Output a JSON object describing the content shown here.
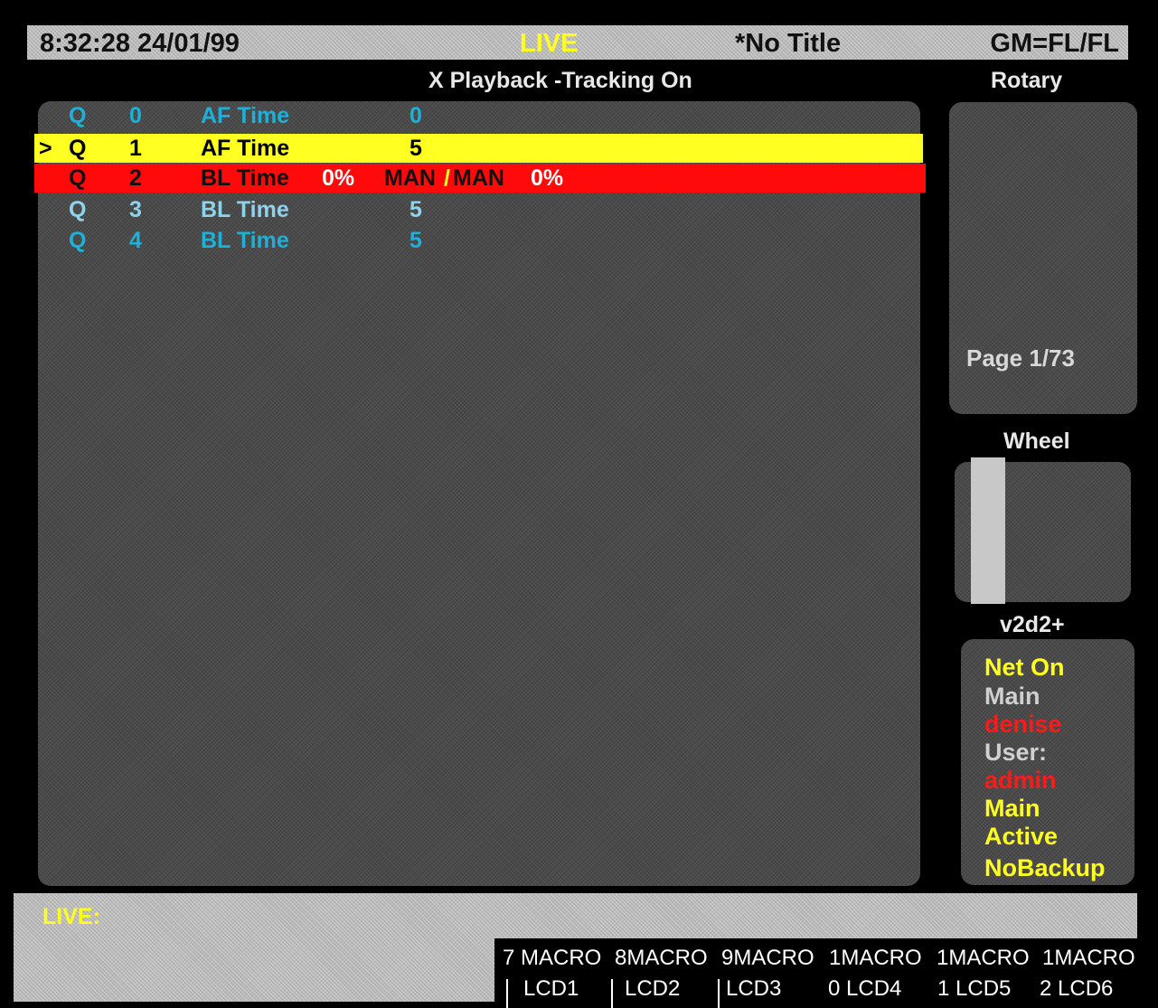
{
  "status_bar": {
    "clock": "8:32:28  24/01/99",
    "mode": "LIVE",
    "show_title": "*No Title",
    "grand_master": "GM=FL/FL"
  },
  "main": {
    "heading": "X Playback -Tracking On",
    "cues": [
      {
        "pointer": "",
        "q": "Q",
        "number": "0",
        "type": "AF Time",
        "value": "0"
      },
      {
        "pointer": ">",
        "q": "Q",
        "number": "1",
        "type": "AF Time",
        "value": "5"
      },
      {
        "pointer": "",
        "q": "Q",
        "number": "2",
        "type": "BL Time",
        "percent": "0%",
        "man_left": "MAN",
        "man_sep": "/",
        "man_right": "MAN",
        "percent2": "0%"
      },
      {
        "pointer": "",
        "q": "Q",
        "number": "3",
        "type": "BL Time",
        "value": "5"
      },
      {
        "pointer": "",
        "q": "Q",
        "number": "4",
        "type": "BL Time",
        "value": "5"
      }
    ]
  },
  "rotary": {
    "heading": "Rotary",
    "page": "Page 1/73"
  },
  "wheel": {
    "heading": "Wheel"
  },
  "network": {
    "heading": "v2d2+",
    "lines": [
      "Net On",
      "Main",
      "denise",
      "User:",
      "admin",
      "Main",
      "Active",
      "NoBackup"
    ]
  },
  "command_line": {
    "label": "LIVE:"
  },
  "macro_keys": [
    {
      "top": "7 MACRO",
      "bottom": "LCD1"
    },
    {
      "top": "8MACRO",
      "bottom": "LCD2"
    },
    {
      "top": "9MACRO",
      "bottom": "LCD3"
    },
    {
      "top": "1MACRO",
      "bottom": "0 LCD4"
    },
    {
      "top": "1MACRO",
      "bottom": "1 LCD5"
    },
    {
      "top": "1MACRO",
      "bottom": "2 LCD6"
    }
  ],
  "colors": {
    "background": "#000000",
    "panel": "#4b4b4b",
    "highlight_yellow": "#ffff22",
    "highlight_red": "#ff0a0a",
    "cue_cyan": "#1eb0d8"
  }
}
